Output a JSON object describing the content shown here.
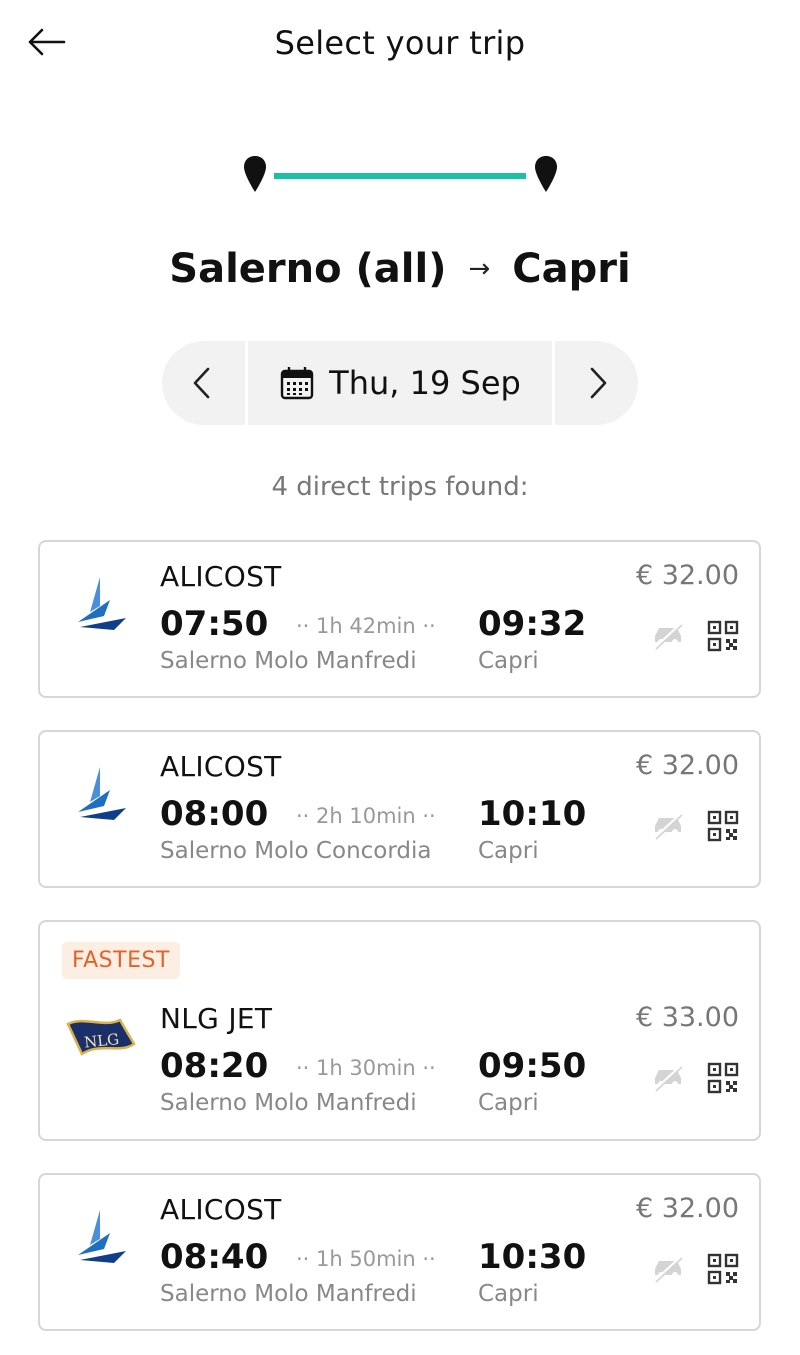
{
  "header": {
    "title": "Select your trip"
  },
  "route": {
    "origin": "Salerno (all)",
    "arrow": "→",
    "destination": "Capri"
  },
  "date_bar": {
    "date": "Thu, 19 Sep"
  },
  "summary": {
    "count_text": "4 direct trips found:"
  },
  "colors": {
    "accent": "#1dbfa6",
    "badge_bg": "#fdeee4",
    "badge_text": "#e2622a"
  },
  "trips": [
    {
      "operator": "ALICOST",
      "departure_time": "07:50",
      "duration": "·· 1h 42min ··",
      "arrival_time": "09:32",
      "departure_port": "Salerno Molo Manfredi",
      "arrival_port": "Capri",
      "price": "€ 32.00",
      "logo": "alicost-logo",
      "badge": ""
    },
    {
      "operator": "ALICOST",
      "departure_time": "08:00",
      "duration": "·· 2h 10min ··",
      "arrival_time": "10:10",
      "departure_port": "Salerno Molo Concordia",
      "arrival_port": "Capri",
      "price": "€ 32.00",
      "logo": "alicost-logo",
      "badge": ""
    },
    {
      "operator": "NLG JET",
      "departure_time": "08:20",
      "duration": "·· 1h 30min ··",
      "arrival_time": "09:50",
      "departure_port": "Salerno Molo Manfredi",
      "arrival_port": "Capri",
      "price": "€ 33.00",
      "logo": "nlg-logo",
      "logo_text": "NLG",
      "badge": "FASTEST"
    },
    {
      "operator": "ALICOST",
      "departure_time": "08:40",
      "duration": "·· 1h 50min ··",
      "arrival_time": "10:30",
      "departure_port": "Salerno Molo Manfredi",
      "arrival_port": "Capri",
      "price": "€ 32.00",
      "logo": "alicost-logo",
      "badge": ""
    }
  ]
}
